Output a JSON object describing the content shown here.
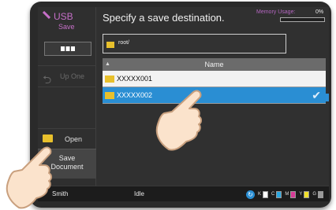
{
  "app": {
    "title": "USB",
    "subtitle": "Save"
  },
  "header": {
    "title": "Specify a save destination.",
    "memory_label": "Memory Usage:",
    "memory_value": "0%",
    "memory_fraction": 0.0
  },
  "sidebar": {
    "view_modes": [
      "grid",
      "list"
    ],
    "selected_view": "list",
    "up_one_label": "Up One",
    "open_label": "Open",
    "save_label_line1": "Save",
    "save_label_line2": "Document"
  },
  "path": {
    "text": "root/"
  },
  "file_list": {
    "column_header": "Name",
    "items": [
      {
        "name": "XXXXX001",
        "selected": false
      },
      {
        "name": "XXXXX002",
        "selected": true
      }
    ]
  },
  "status_bar": {
    "user": "Smith",
    "state": "Idle",
    "toner": [
      {
        "label": "K",
        "color": "#ffffff"
      },
      {
        "label": "C",
        "color": "#2aa7e0"
      },
      {
        "label": "M",
        "color": "#d63a96"
      },
      {
        "label": "Y",
        "color": "#f1df2a"
      },
      {
        "label": "G",
        "color": "#9a9a9a"
      }
    ]
  },
  "colors": {
    "accent": "#2a8ed3",
    "usb_accent": "#c66fc8",
    "folder": "#e8c02c"
  }
}
